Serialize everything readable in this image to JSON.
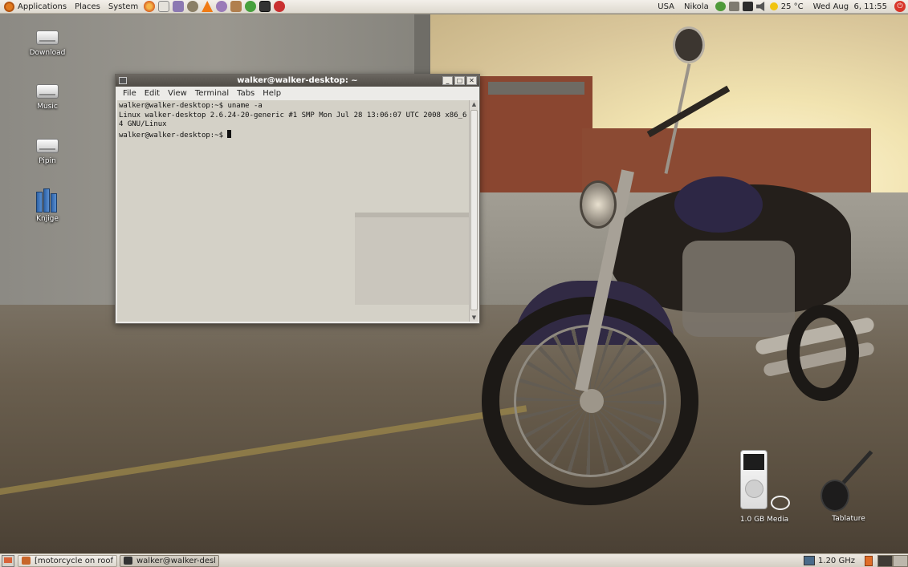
{
  "top_panel": {
    "menus": [
      "Applications",
      "Places",
      "System"
    ],
    "launchers": [
      {
        "icon": "firefox-icon",
        "color": "#e67a1e"
      },
      {
        "icon": "mail-icon",
        "color": "#d8d4cc"
      },
      {
        "icon": "pidgin-icon",
        "color": "#8c79b2"
      },
      {
        "icon": "gimp-icon",
        "color": "#8a7f66"
      },
      {
        "icon": "vlc-icon",
        "color": "#f07b15"
      },
      {
        "icon": "pidgin-chat-icon",
        "color": "#9a7bb8"
      },
      {
        "icon": "package-icon",
        "color": "#b07f4e"
      },
      {
        "icon": "media-player-icon",
        "color": "#47a13d"
      },
      {
        "icon": "terminal-icon",
        "color": "#333333"
      },
      {
        "icon": "help-icon",
        "color": "#c93030"
      }
    ],
    "locale": "USA",
    "user": "Nikola",
    "temperature": "25 °C",
    "clock": "Wed Aug  6, 11:55"
  },
  "desktop_icons": [
    {
      "label": "Download",
      "type": "drive"
    },
    {
      "label": "Music",
      "type": "drive"
    },
    {
      "label": "Pipin",
      "type": "drive"
    },
    {
      "label": "Knjige",
      "type": "books"
    }
  ],
  "terminal": {
    "title": "walker@walker-desktop: ~",
    "menu": [
      "File",
      "Edit",
      "View",
      "Terminal",
      "Tabs",
      "Help"
    ],
    "lines": [
      "walker@walker-desktop:~$ uname -a",
      "Linux walker-desktop 2.6.24-20-generic #1 SMP Mon Jul 28 13:06:07 UTC 2008 x86_6",
      "4 GNU/Linux",
      "walker@walker-desktop:~$ "
    ]
  },
  "dock": {
    "ipod_label": "1.0 GB Media",
    "guitar_label": "Tablature"
  },
  "bottom_panel": {
    "tasks": [
      {
        "label": "[motorcycle on rooft...",
        "active": false
      },
      {
        "label": "walker@walker-deskt...",
        "active": true
      }
    ],
    "cpu_freq": "1.20 GHz"
  }
}
